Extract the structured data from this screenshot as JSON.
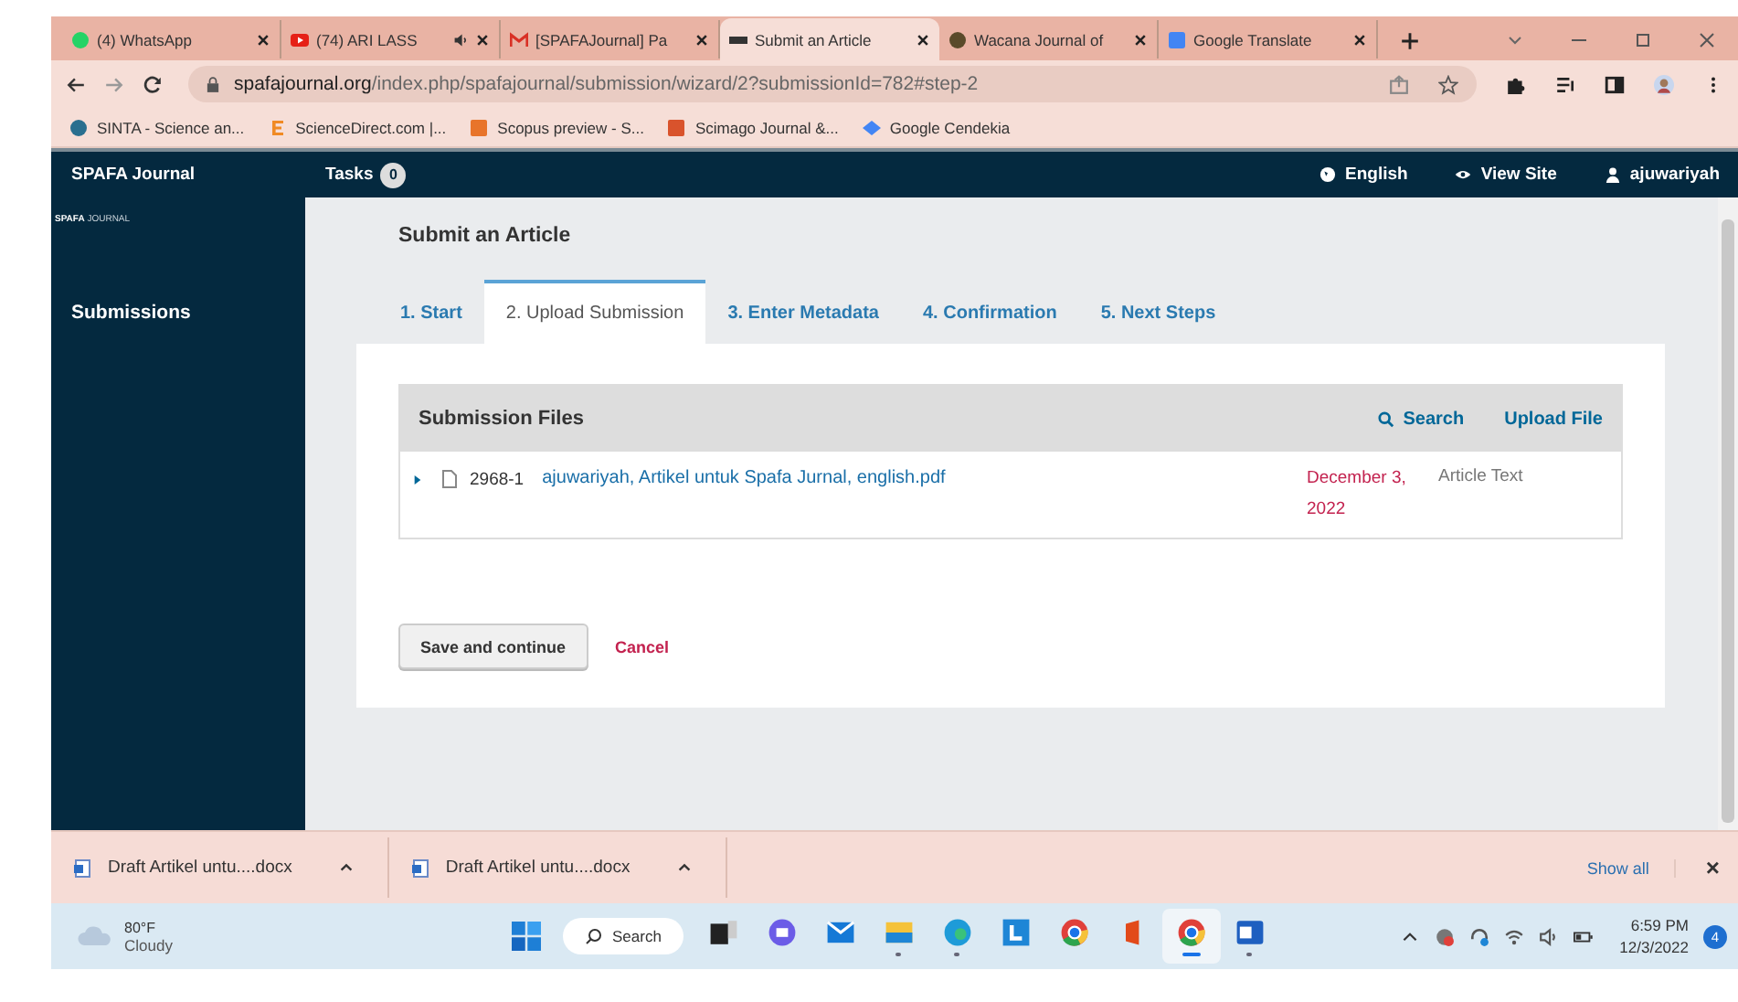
{
  "browser": {
    "tabs": [
      {
        "title": "(4) WhatsApp",
        "kind": "whatsapp",
        "audio": false,
        "selected": false
      },
      {
        "title": "(74) ARI LASS",
        "kind": "youtube",
        "audio": true,
        "selected": false
      },
      {
        "title": "[SPAFAJournal] Pa",
        "kind": "gmail",
        "audio": false,
        "selected": false
      },
      {
        "title": "Submit an Article",
        "kind": "pkp",
        "audio": false,
        "selected": true
      },
      {
        "title": "Wacana Journal of",
        "kind": "globe",
        "audio": false,
        "selected": false
      },
      {
        "title": "Google Translate",
        "kind": "translate",
        "audio": false,
        "selected": false
      }
    ],
    "url_host": "spafajournal.org",
    "url_path": "/index.php/spafajournal/submission/wizard/2?submissionId=782#step-2",
    "bookmarks": [
      {
        "label": "SINTA - Science an...",
        "kind": "sinta"
      },
      {
        "label": "ScienceDirect.com |...",
        "kind": "elsevier"
      },
      {
        "label": "Scopus preview - S...",
        "kind": "scopus"
      },
      {
        "label": "Scimago Journal &...",
        "kind": "scimago"
      },
      {
        "label": "Google Cendekia",
        "kind": "scholar"
      }
    ]
  },
  "site": {
    "name": "SPAFA Journal",
    "logo_word": "SPAFA",
    "logo_sub": "JOURNAL",
    "tasks_label": "Tasks",
    "tasks_count": "0",
    "language": "English",
    "view_site": "View Site",
    "user": "ajuwariyah",
    "sidebar": [
      {
        "label": "Submissions",
        "selected": false
      }
    ]
  },
  "page": {
    "title": "Submit an Article",
    "steps": [
      {
        "label": "1. Start",
        "selected": false
      },
      {
        "label": "2. Upload Submission",
        "selected": true
      },
      {
        "label": "3. Enter Metadata",
        "selected": false
      },
      {
        "label": "4. Confirmation",
        "selected": false
      },
      {
        "label": "5. Next Steps",
        "selected": false
      }
    ],
    "files": {
      "title": "Submission Files",
      "search": "Search",
      "upload": "Upload File",
      "rows": [
        {
          "id": "2968-1",
          "name": "ajuwariyah, Artikel untuk Spafa Jurnal, english.pdf",
          "date": "December 3, 2022",
          "type": "Article Text",
          "expanded": false
        }
      ]
    },
    "save": "Save and continue",
    "cancel": "Cancel"
  },
  "downloads": {
    "items": [
      "Draft Artikel untu....docx",
      "Draft Artikel untu....docx"
    ],
    "show_all": "Show all",
    "close": "×"
  },
  "taskbar": {
    "temperature": "80°F",
    "weather": "Cloudy",
    "search": "Search",
    "apps": [
      {
        "kind": "taskview",
        "running": false,
        "selected": false
      },
      {
        "kind": "chat",
        "running": false,
        "selected": false
      },
      {
        "kind": "mail",
        "running": false,
        "selected": false
      },
      {
        "kind": "folder",
        "running": true,
        "selected": false
      },
      {
        "kind": "edge",
        "running": true,
        "selected": false
      },
      {
        "kind": "lapp",
        "running": false,
        "selected": false
      },
      {
        "kind": "chrome",
        "running": false,
        "selected": false
      },
      {
        "kind": "office",
        "running": false,
        "selected": false
      },
      {
        "kind": "chrome",
        "running": true,
        "selected": true
      },
      {
        "kind": "word",
        "running": true,
        "selected": false
      }
    ],
    "time": "6:59 PM",
    "date": "12/3/2022",
    "notifications": "4"
  }
}
